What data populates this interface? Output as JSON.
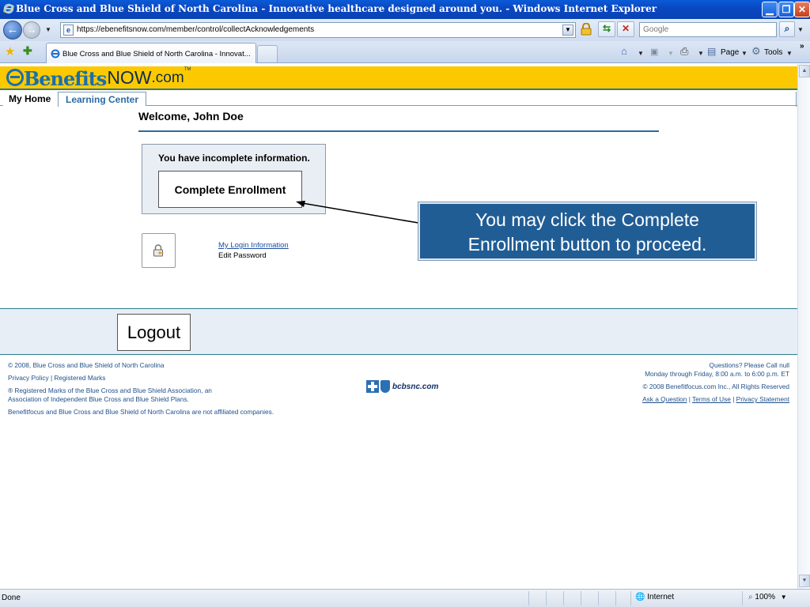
{
  "window": {
    "title": "Blue Cross and Blue Shield of North Carolina - Innovative healthcare designed around you. - Windows Internet Explorer"
  },
  "addressbar": {
    "url": "https://ebenefitsnow.com/member/control/collectAcknowledgements",
    "search_placeholder": "Google"
  },
  "tabbar": {
    "active_tab_title": "Blue Cross and Blue Shield of North Carolina - Innovat...",
    "page_label": "Page",
    "tools_label": "Tools"
  },
  "site": {
    "logo": {
      "benefits": "Benefits",
      "now": "NOW",
      "dotcom": ".com",
      "tm": "TM"
    },
    "nav": {
      "my_home": "My Home",
      "learning_center": "Learning Center"
    },
    "welcome": "Welcome, John Doe",
    "incomplete_message": "You have incomplete information.",
    "complete_button": "Complete Enrollment",
    "login_info_link": "My Login Information",
    "edit_password": "Edit Password",
    "logout_button": "Logout"
  },
  "callout": {
    "line1": "You may click the Complete",
    "line2": "Enrollment button to proceed."
  },
  "footer": {
    "copyright": "© 2008, Blue Cross and Blue Shield of North Carolina",
    "privacy_policy": "Privacy Policy",
    "separator": "|",
    "registered_marks": "Registered Marks",
    "registered_line1": "® Registered Marks of the Blue Cross and Blue Shield Association, an",
    "registered_line2": "Association of Independent Blue Cross and Blue Shield Plans.",
    "not_affiliated": "Benefitfocus and Blue Cross and Blue Shield of North Carolina are not affiliated companies.",
    "bcbs_name": "bcbsnc.com",
    "questions": "Questions? Please Call null",
    "hours": "Monday through Friday, 8:00 a.m. to 6:00 p.m. ET",
    "benefitfocus_copyright": "© 2008 Benefitfocus.com Inc., All Rights Reserved",
    "ask_question": "Ask a Question",
    "terms_of_use": "Terms of Use",
    "privacy_statement": "Privacy Statement"
  },
  "statusbar": {
    "status": "Done",
    "zone": "Internet",
    "zoom": "100%"
  },
  "colors": {
    "banner_yellow": "#fcc900",
    "brand_blue": "#1b6fa9",
    "callout_blue": "#215d95",
    "link_blue": "#1f4fa6"
  }
}
